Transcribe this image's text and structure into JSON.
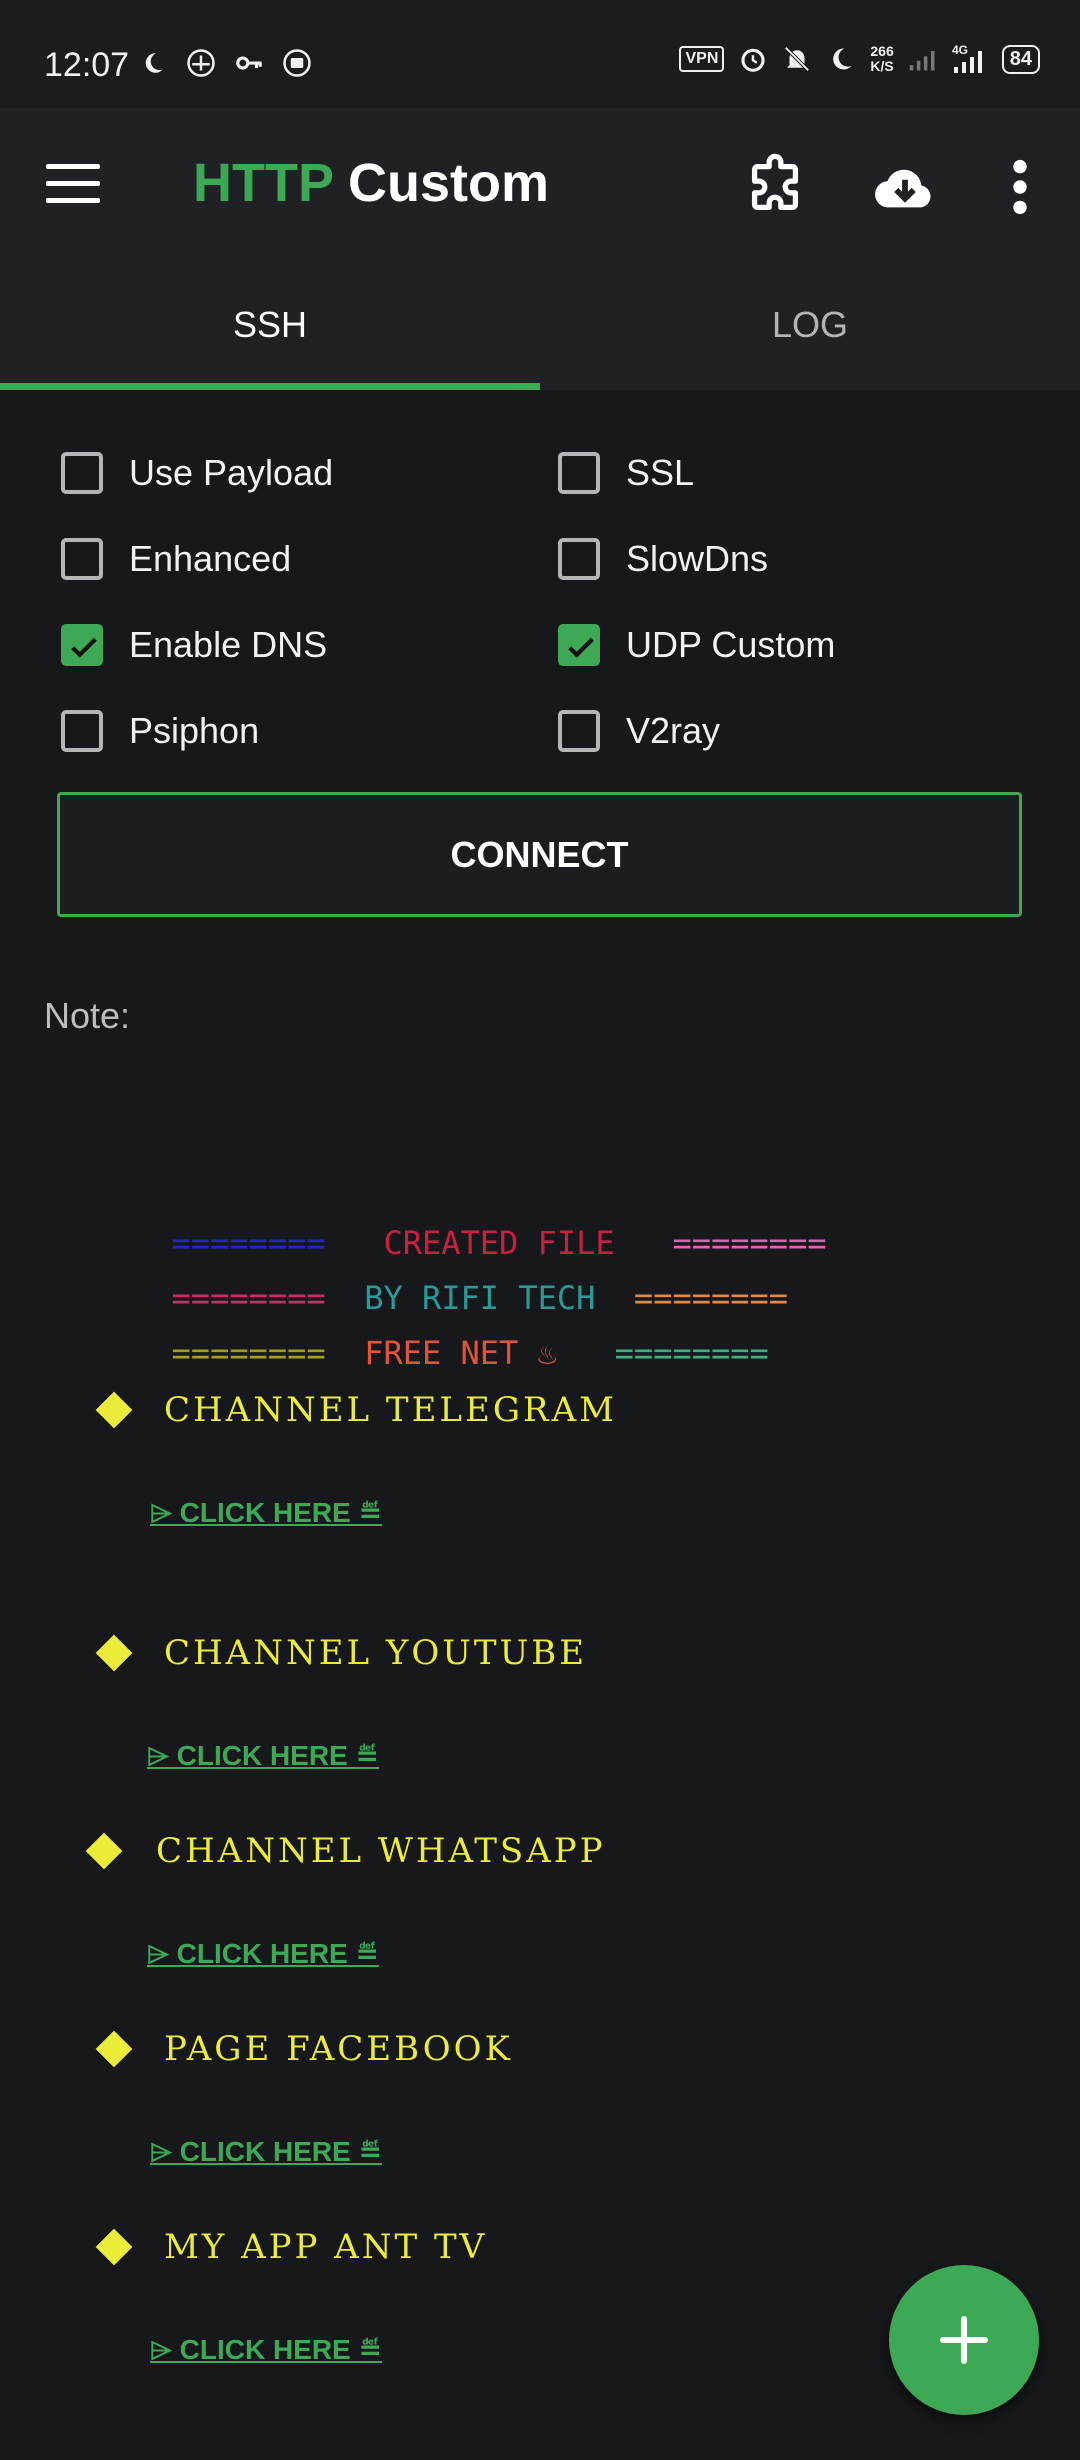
{
  "status_bar": {
    "time": "12:07",
    "vpn": "VPN",
    "speed_value": "266",
    "speed_unit": "K/S",
    "network": "4G",
    "battery": "84"
  },
  "app_bar": {
    "title_part1": "HTTP",
    "title_part2": " Custom",
    "icons": [
      "menu-icon",
      "puzzle-icon",
      "cloud-download-icon",
      "more-vert-icon"
    ]
  },
  "tabs": [
    {
      "label": "SSH",
      "selected": true
    },
    {
      "label": "LOG",
      "selected": false
    }
  ],
  "options": [
    {
      "label": "Use Payload",
      "checked": false
    },
    {
      "label": "SSL",
      "checked": false
    },
    {
      "label": "Enhanced",
      "checked": false
    },
    {
      "label": "SlowDns",
      "checked": false
    },
    {
      "label": "Enable DNS",
      "checked": true
    },
    {
      "label": "UDP Custom",
      "checked": true
    },
    {
      "label": "Psiphon",
      "checked": false
    },
    {
      "label": "V2ray",
      "checked": false
    }
  ],
  "connect_label": "CONNECT",
  "note": {
    "label": "Note:",
    "banner": [
      {
        "left": "========",
        "center": "CREATED FILE",
        "right": "========"
      },
      {
        "left": "========",
        "center": "BY RIFI TECH",
        "right": "========"
      },
      {
        "left": "========",
        "center": "FREE NET ♨",
        "right": "========"
      }
    ],
    "sections": [
      {
        "heading": "CHANNEL TELEGRAM",
        "link": "⌲ CLICK HERE ≝"
      },
      {
        "heading": "CHANNEL YOUTUBE",
        "link": "⌲ CLICK HERE ≝"
      },
      {
        "heading": "CHANNEL WHATSAPP",
        "link": "⌲ CLICK HERE ≝"
      },
      {
        "heading": "PAGE FACEBOOK",
        "link": "⌲ CLICK HERE ≝"
      },
      {
        "heading": "MY APP ANT TV",
        "link": "⌲ CLICK HERE ≝"
      }
    ]
  },
  "colors": {
    "accent": "#3da955",
    "background": "#17181c",
    "heading_yellow": "#ecec3a",
    "banner_row1_left": "#2525c8",
    "banner_row1_center": "#cc1f3f",
    "banner_row1_right": "#e065b0",
    "banner_row2_left": "#cc2a6a",
    "banner_row2_center": "#2a9a98",
    "banner_row2_right": "#e08a4a",
    "banner_row3_left": "#a0a020",
    "banner_row3_center": "#e0553a",
    "banner_row3_right": "#3ab080"
  },
  "fab_icon": "plus-icon"
}
